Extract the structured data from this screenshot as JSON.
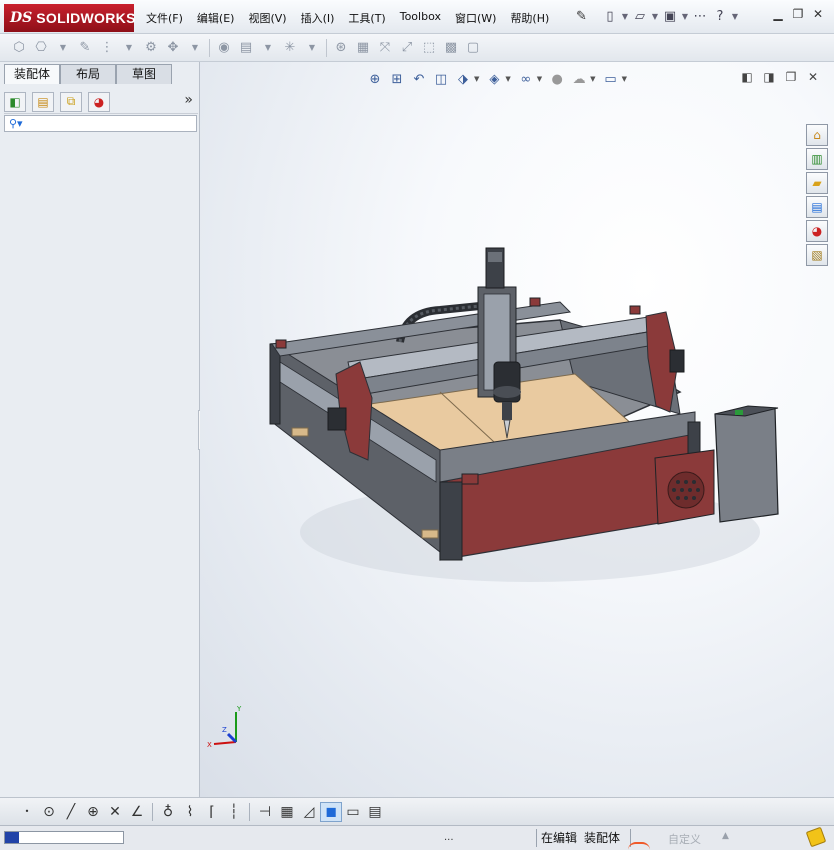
{
  "title_bar": {
    "brand_ds": "DS",
    "brand_name": "SOLIDWORKS"
  },
  "menu": {
    "items": [
      "文件(F)",
      "编辑(E)",
      "视图(V)",
      "插入(I)",
      "工具(T)",
      "Toolbox",
      "窗口(W)",
      "帮助(H)"
    ]
  },
  "quick_access": {
    "icons": [
      "new-document-icon",
      "open-icon",
      "save-icon",
      "help-icon"
    ]
  },
  "feature_manager": {
    "tabs": [
      "装配体",
      "布局",
      "草图"
    ],
    "active_tab": "装配体",
    "expand_glyph": "»"
  },
  "status_bar": {
    "dots": "...",
    "editing": "在编辑",
    "mode": "装配体",
    "custom": "自定义",
    "progress": 0.12
  },
  "viewport": {
    "triad": {
      "x": "X",
      "y": "Y",
      "z": "Z"
    },
    "colors": {
      "frame_red": "#8b3a3a",
      "bed": "#e9caa0",
      "rail": "#9aa1ab",
      "dark": "#3d4148"
    }
  }
}
